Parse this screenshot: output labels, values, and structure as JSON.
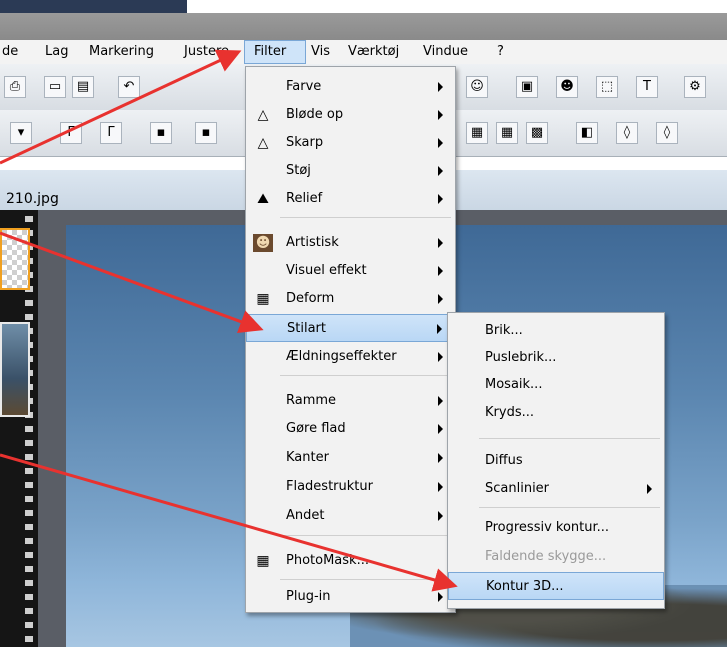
{
  "menubar": {
    "items": [
      "de",
      "Lag",
      "Markering",
      "Justere",
      "Filter",
      "Vis",
      "Værktøj",
      "Vindue",
      "?"
    ]
  },
  "tab": {
    "filename": "210.jpg"
  },
  "filter_menu": {
    "items": [
      {
        "label": "Farve",
        "submenu": true,
        "icon": "none"
      },
      {
        "label": "Bløde op",
        "submenu": true,
        "icon": "soften-triangle-icon"
      },
      {
        "label": "Skarp",
        "submenu": true,
        "icon": "sharpen-triangle-icon"
      },
      {
        "label": "Støj",
        "submenu": true,
        "icon": "none"
      },
      {
        "label": "Relief",
        "submenu": true,
        "icon": "relief-icon"
      },
      {
        "label": "Artistisk",
        "submenu": true,
        "icon": "artistic-portrait-icon"
      },
      {
        "label": "Visuel effekt",
        "submenu": true,
        "icon": "none"
      },
      {
        "label": "Deform",
        "submenu": true,
        "icon": "deform-grid-icon"
      },
      {
        "label": "Stilart",
        "submenu": true,
        "icon": "none",
        "highlighted": true
      },
      {
        "label": "Ældningseffekter",
        "submenu": true,
        "icon": "none"
      },
      {
        "label": "Ramme",
        "submenu": true,
        "icon": "none"
      },
      {
        "label": "Gøre flad",
        "submenu": true,
        "icon": "none"
      },
      {
        "label": "Kanter",
        "submenu": true,
        "icon": "none"
      },
      {
        "label": "Fladestruktur",
        "submenu": true,
        "icon": "none"
      },
      {
        "label": "Andet",
        "submenu": true,
        "icon": "none"
      },
      {
        "label": "PhotoMask...",
        "submenu": false,
        "icon": "photomask-icon"
      },
      {
        "label": "Plug-in",
        "submenu": true,
        "icon": "none"
      }
    ]
  },
  "stilart_submenu": {
    "items": [
      {
        "label": "Brik...",
        "submenu": false
      },
      {
        "label": "Puslebrik...",
        "submenu": false
      },
      {
        "label": "Mosaik...",
        "submenu": false
      },
      {
        "label": "Kryds...",
        "submenu": false
      },
      {
        "label": "Diffus",
        "submenu": false
      },
      {
        "label": "Scanlinier",
        "submenu": true
      },
      {
        "label": "Progressiv kontur...",
        "submenu": false
      },
      {
        "label": "Faldende skygge...",
        "submenu": false,
        "disabled": true
      },
      {
        "label": "Kontur 3D...",
        "submenu": false,
        "highlighted": true
      }
    ]
  },
  "colors": {
    "highlight": "#cfe4f9",
    "arrow": "#e8322f",
    "menu_bg": "#f2f2f2"
  }
}
